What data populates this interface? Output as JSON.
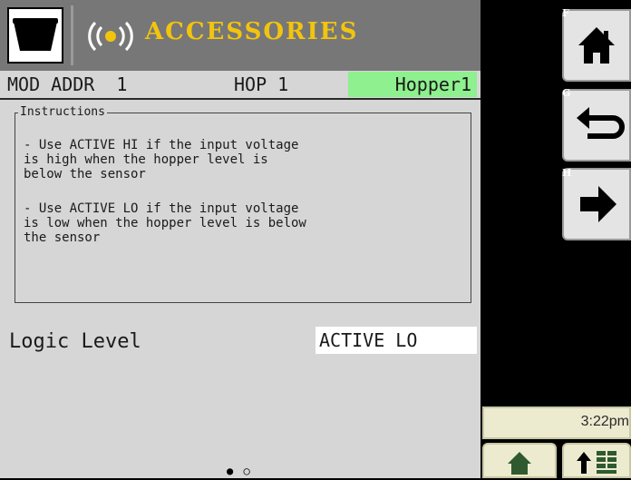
{
  "header": {
    "title": "ACCESSORIES",
    "title_color": "#f2c40e",
    "icon_left": "hopper-icon",
    "icon_signal": "wireless-signal-icon"
  },
  "info_row": {
    "mod_addr": "MOD ADDR  1",
    "hop_label": "HOP 1",
    "hopper_name": "Hopper1",
    "hopper_name_bg": "#8ef08e"
  },
  "instructions": {
    "title": "Instructions",
    "paragraph_1": "- Use ACTIVE HI if the input voltage\nis high when the hopper level is\nbelow the sensor",
    "paragraph_2": "- Use ACTIVE LO if the input voltage\nis low when the hopper level is below\nthe sensor"
  },
  "logic": {
    "label": "Logic Level",
    "value": "ACTIVE LO"
  },
  "pagination": {
    "dots": "● ○"
  },
  "softkeys": {
    "f": {
      "letter": "F",
      "icon": "home-icon"
    },
    "g": {
      "letter": "G",
      "icon": "back-arrow-icon"
    },
    "h": {
      "letter": "H",
      "icon": "right-arrow-icon"
    }
  },
  "status": {
    "clock": "3:22pm"
  },
  "bottom_bar": {
    "home_icon": "home-icon",
    "menu_icon": "up-arrow-grid-icon"
  }
}
